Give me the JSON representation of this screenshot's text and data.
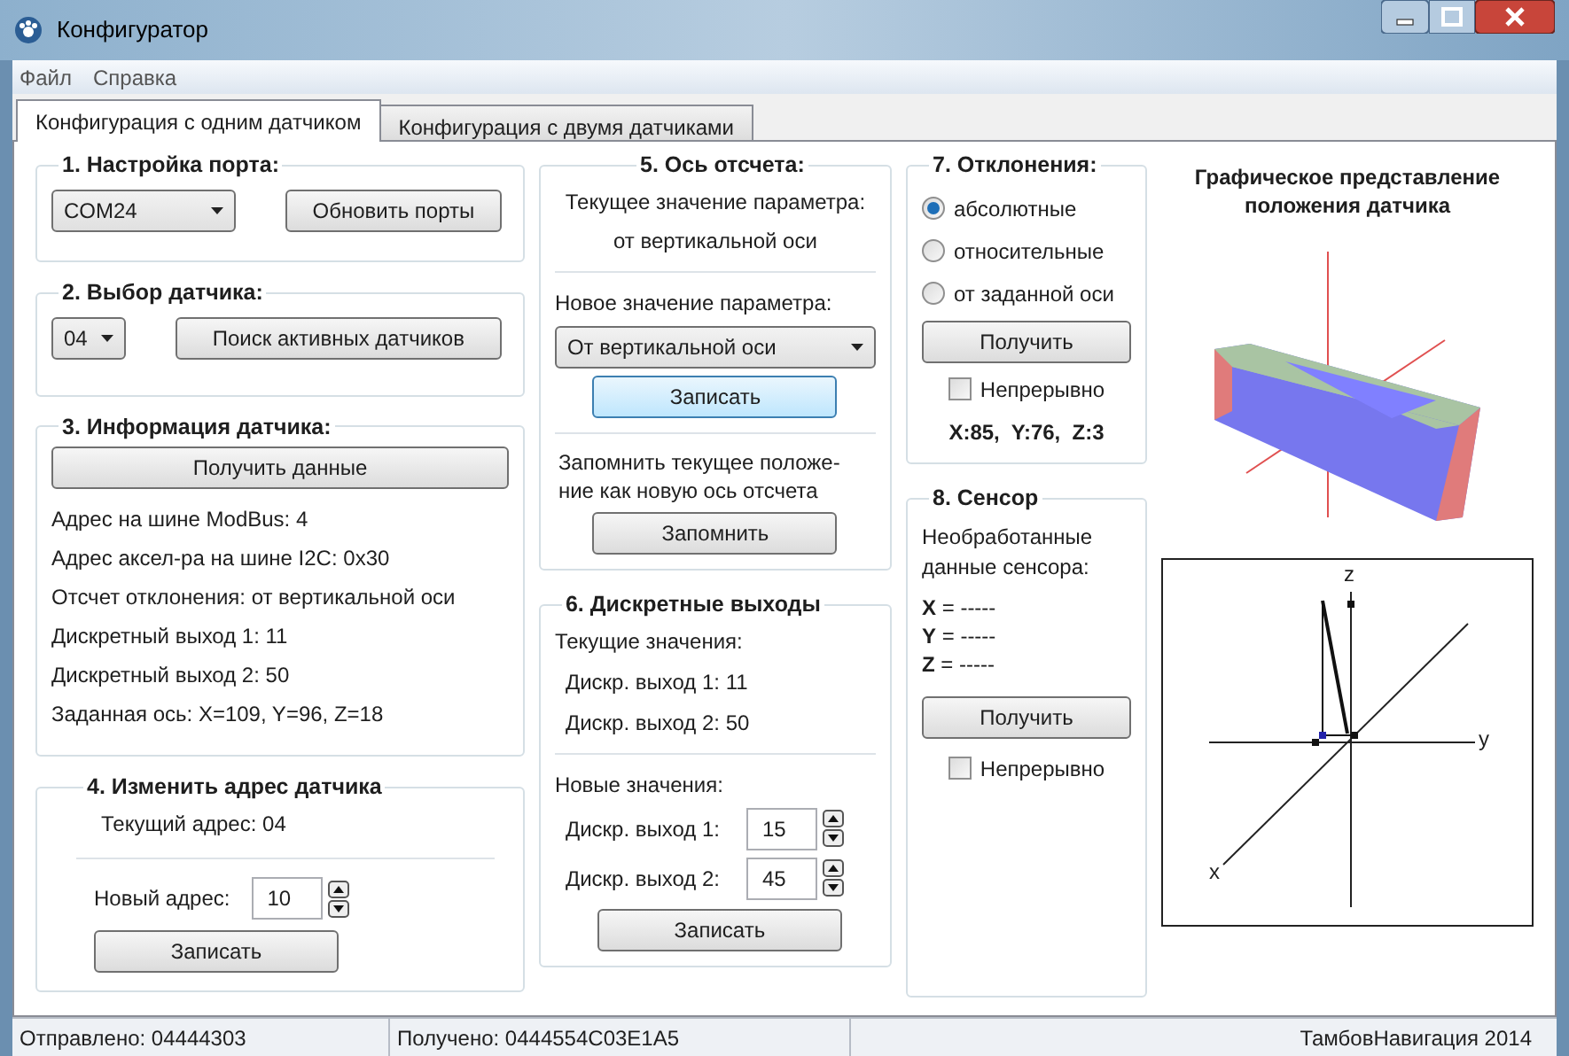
{
  "window": {
    "title": "Конфигуратор"
  },
  "menu": [
    "Файл",
    "Справка"
  ],
  "tabs": [
    {
      "label": "Конфигурация с одним датчиком",
      "selected": true
    },
    {
      "label": "Конфигурация с двумя датчиками",
      "selected": false
    }
  ],
  "port": {
    "title": "1. Настройка порта:",
    "combo": "COM24",
    "button": "Обновить порты"
  },
  "sensor_select": {
    "title": "2. Выбор датчика:",
    "combo": "04",
    "button": "Поиск активных датчиков"
  },
  "info": {
    "title": "3. Информация датчика:",
    "button": "Получить данные",
    "lines": [
      "Адрес на шине ModBus: 4",
      "Адрес аксел-ра на шине I2C: 0x30",
      "Отсчет отклонения: от вертикальной оси",
      "Дискретный выход 1: 11",
      "Дискретный выход 2: 50",
      "Заданная ось: X=109, Y=96, Z=18"
    ]
  },
  "change_address": {
    "title": "4. Изменить адрес датчика",
    "current": "Текущий адрес: 04",
    "new_label": "Новый адрес:",
    "new_value": "10",
    "button": "Записать"
  },
  "axis": {
    "title": "5. Ось отсчета:",
    "current_label": "Текущее значение параметра:",
    "current_value": "от вертикальной оси",
    "new_label": "Новое значение параметра:",
    "combo": "От вертикальной оси",
    "write_button": {
      "label": "Записать",
      "highlighted": true
    },
    "remember_text": "Запомнить текущее положе-ние как новую ось отсчета",
    "remember_button": {
      "label": "Запомнить",
      "highlighted": false
    }
  },
  "outputs": {
    "title": "6. Дискретные выходы",
    "current_label": "Текущие значения:",
    "current": [
      "Дискр. выход 1: 11",
      "Дискр. выход 2: 50"
    ],
    "new_label": "Новые значения:",
    "new": [
      {
        "label": "Дискр. выход 1:",
        "value": "15"
      },
      {
        "label": "Дискр. выход 2:",
        "value": "45"
      }
    ],
    "button": "Записать"
  },
  "deviation": {
    "title": "7. Отклонения:",
    "options": [
      {
        "label": "абсолютные",
        "selected": true
      },
      {
        "label": "относительные",
        "selected": false
      },
      {
        "label": "от заданной оси",
        "selected": false
      }
    ],
    "button": "Получить",
    "continuous": {
      "label": "Непрерывно",
      "checked": false
    },
    "reading": "X:85,  Y:76,  Z:3"
  },
  "sensor": {
    "title": "8. Сенсор",
    "caption": "Необработанные данные сенсора:",
    "values": [
      "**X** = -----",
      "**Y** = -----",
      "**Z** = -----"
    ],
    "button": "Получить",
    "continuous": {
      "label": "Непрерывно",
      "checked": false
    }
  },
  "graphic": {
    "title": "Графическое представление положения датчика",
    "plot_axes": [
      "z",
      "y",
      "x"
    ]
  },
  "status_bar": [
    "Отправлено: 04444303",
    "Получено: 0444554C03E1A5",
    "ТамбовНавигация 2014"
  ]
}
